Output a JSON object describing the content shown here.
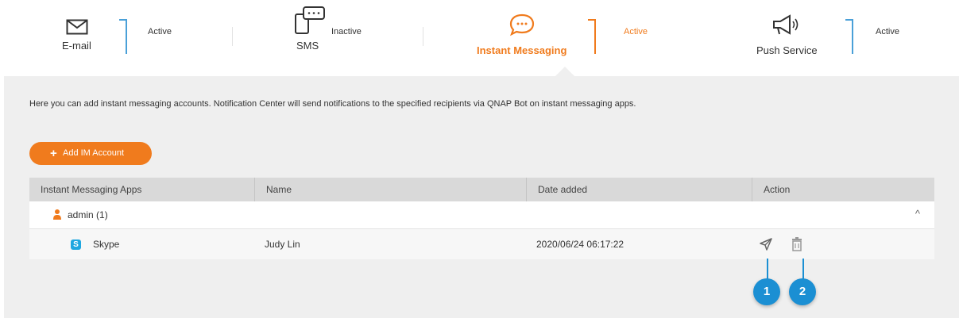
{
  "tabs": [
    {
      "label": "E-mail",
      "status": "Active",
      "icon": "envelope-icon"
    },
    {
      "label": "SMS",
      "status": "Inactive",
      "icon": "sms-phone-icon"
    },
    {
      "label": "Instant Messaging",
      "status": "Active",
      "icon": "chat-bubble-icon"
    },
    {
      "label": "Push Service",
      "status": "Active",
      "icon": "megaphone-icon"
    }
  ],
  "description": "Here you can add instant messaging accounts. Notification Center will send notifications to the specified recipients via QNAP Bot on instant messaging apps.",
  "add_button": {
    "plus": "+",
    "label": "Add IM Account"
  },
  "table": {
    "columns": [
      "Instant Messaging Apps",
      "Name",
      "Date added",
      "Action"
    ],
    "group": {
      "label": "admin (1)",
      "icon": "user-icon",
      "toggle": "^"
    },
    "rows": [
      {
        "app": "Skype",
        "app_icon_text": "S",
        "name": "Judy Lin",
        "date_added": "2020/06/24 06:17:22",
        "actions": [
          "send-test-icon",
          "trash-icon"
        ]
      }
    ]
  },
  "callouts": [
    "1",
    "2"
  ],
  "colors": {
    "accent": "#f07b1d",
    "status_bar": "#4aa0d8",
    "callout": "#1b8fd3",
    "skype": "#1fa7e0"
  }
}
